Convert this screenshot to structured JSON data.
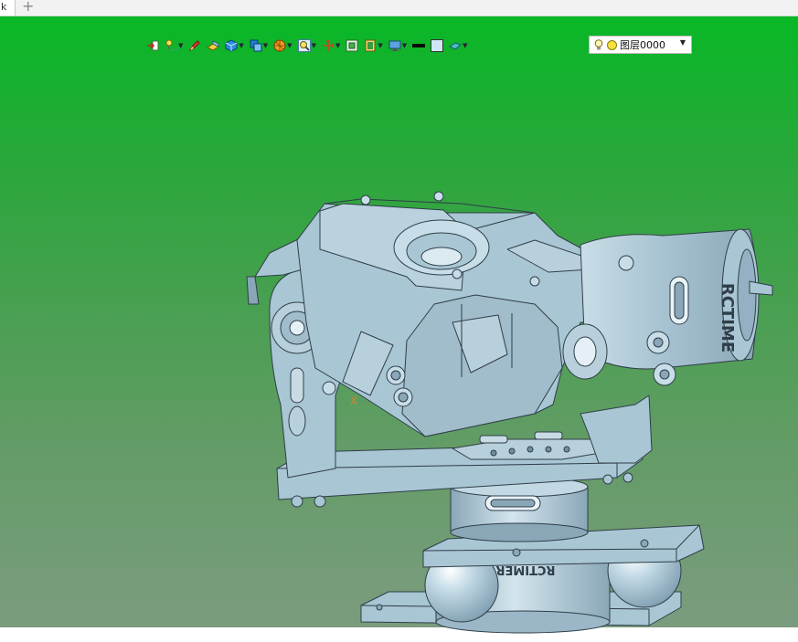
{
  "tabs": {
    "current_tab_fragment": "k",
    "new_tab_symbol": "+"
  },
  "toolbar": {
    "buttons": [
      {
        "icon": "exit-arrow-icon",
        "dropdown": false
      },
      {
        "icon": "light-snap-icon",
        "dropdown": true
      },
      {
        "icon": "pencil-sketch-icon",
        "dropdown": false
      },
      {
        "icon": "yellow-block-icon",
        "dropdown": false
      },
      {
        "icon": "blue-cube-icon",
        "dropdown": true
      },
      {
        "icon": "cube-views-icon",
        "dropdown": true
      },
      {
        "icon": "render-ball-icon",
        "dropdown": true
      },
      {
        "icon": "zoom-magnifier-icon",
        "dropdown": true
      },
      {
        "icon": "pan-axes-icon",
        "dropdown": true
      },
      {
        "icon": "fit-view-icon",
        "dropdown": false
      },
      {
        "icon": "panel-frame-icon",
        "dropdown": true
      },
      {
        "icon": "monitor-display-icon",
        "dropdown": true
      },
      {
        "icon": "black-line-icon",
        "dropdown": false
      },
      {
        "icon": "square-color-icon",
        "dropdown": false
      },
      {
        "icon": "plane-surface-icon",
        "dropdown": true
      }
    ],
    "layer": {
      "name": "图层0000"
    }
  },
  "model": {
    "brand_text": "RCTIMER",
    "brand_text_partial": "RCTIME",
    "base_brand_text": "RCTIMER",
    "axis_label": "X",
    "colors": {
      "part": "#a9c6d4",
      "edge": "#2f3e48",
      "background_top": "#08b826",
      "background_bottom": "#7b9c7f"
    }
  }
}
